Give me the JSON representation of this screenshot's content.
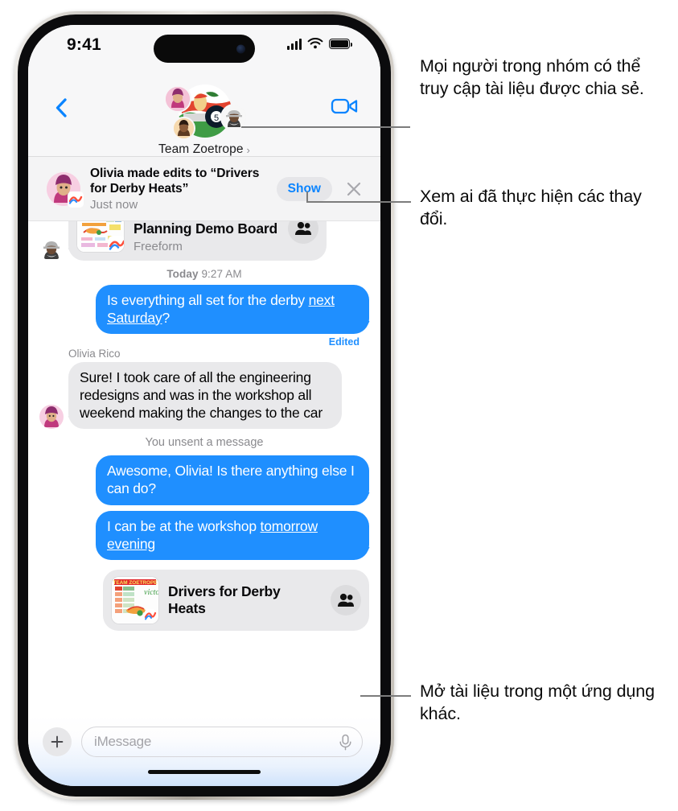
{
  "device": {
    "status_bar": {
      "time": "9:41",
      "cellular_icon": "cellular-bars-icon",
      "wifi_icon": "wifi-icon",
      "battery_icon": "battery-full-icon"
    },
    "home_indicator": "home-indicator"
  },
  "nav": {
    "back_icon": "chevron-left-icon",
    "facetime_icon": "video-camera-icon",
    "group_name": "Team Zoetrope",
    "group_chevron": "chevron-right-icon",
    "avatar_main": "group-avatar-soapbox-car",
    "avatar_1": "member-avatar-olivia",
    "avatar_2": "member-avatar-member3",
    "avatar_3": "member-avatar-member2"
  },
  "banner": {
    "avatar": "olivia-avatar",
    "app_badge": "freeform-badge-icon",
    "title": "Olivia made edits to “Drivers for Derby Heats”",
    "subtitle": "Just now",
    "show_label": "Show",
    "close_icon": "close-icon"
  },
  "conversation": {
    "shared_doc_top": {
      "avatar": "sender-avatar-memoji",
      "thumbnail": "freeform-board-thumbnail",
      "app_badge": "freeform-app-icon",
      "title": "Soapbox Derby Planning Demo Board",
      "app": "Freeform",
      "people_icon": "people-icon"
    },
    "timestamp": "Today 9:27 AM",
    "timestamp_day": "Today",
    "timestamp_time": "9:27 AM",
    "messages": [
      {
        "id": "msg-derby-question",
        "side": "out",
        "text_before": "Is everything all set for the derby ",
        "link_text": "next Saturday",
        "text_after": "?",
        "status": "Edited"
      },
      {
        "id": "msg-olivia-reply",
        "side": "in",
        "sender": "Olivia Rico",
        "text": "Sure! I took care of all the engineering redesigns and was in the workshop all weekend making the changes to the car",
        "avatar": "olivia-avatar"
      },
      {
        "id": "msg-awesome",
        "side": "out",
        "text": "Awesome, Olivia! Is there anything else I can do?"
      },
      {
        "id": "msg-workshop",
        "side": "out",
        "text_before": "I can be at the workshop ",
        "link_text": "tomorrow evening",
        "text_after": ""
      }
    ],
    "unsent_notice": "You unsent a message",
    "shared_doc_bottom": {
      "thumbnail": "team-zoetrope-victory-thumbnail",
      "app_badge": "freeform-app-icon",
      "title": "Drivers for Derby Heats",
      "people_icon": "people-icon"
    }
  },
  "compose": {
    "plus_icon": "plus-icon",
    "placeholder": "iMessage",
    "mic_icon": "microphone-icon"
  },
  "callouts": [
    {
      "id": "callout-shared-doc-access",
      "text": "Mọi người trong nhóm có thể truy cập tài liệu được chia sẻ."
    },
    {
      "id": "callout-see-who-changed",
      "text": "Xem ai đã thực hiện các thay đổi."
    },
    {
      "id": "callout-open-in-other-app",
      "text": "Mở tài liệu trong một ứng dụng khác."
    }
  ],
  "colors": {
    "accent_blue": "#1f8fff",
    "bubble_in": "#e9e9eb",
    "header_bg": "#f7f7f8",
    "secondary_text": "#8a8a8e",
    "leader_line": "#7c7c7c"
  }
}
